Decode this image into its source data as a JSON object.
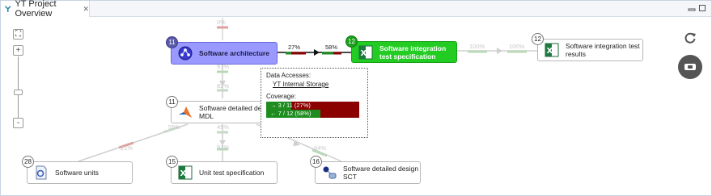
{
  "window": {
    "tab_title": "YT Project Overview",
    "tab_close": "✕",
    "icons": [
      "project-overview-icon",
      "minimize-icon",
      "maximize-icon"
    ]
  },
  "zoom": {
    "fit_label": "⛶",
    "plus_label": "+",
    "minus_label": "-"
  },
  "colors": {
    "selected": "#9999ff",
    "active": "#22cc22",
    "covered": "#1e8c1e",
    "uncovered": "#8b0000",
    "faint": "#c8c8c8"
  },
  "nodes": {
    "architecture": {
      "count": "11",
      "label": "Software architecture",
      "icon": "architecture-icon"
    },
    "integration_spec": {
      "count": "12",
      "label": "Software integration test specification",
      "icon": "excel-icon"
    },
    "integration_results": {
      "count": "12",
      "label": "Software integration test results",
      "icon": "excel-icon"
    },
    "detailed_mdl": {
      "count": "11",
      "label": "Software detailed design MDL",
      "icon": "matlab-icon"
    },
    "units": {
      "count": "28",
      "label": "Software units",
      "icon": "code-file-icon"
    },
    "unit_test": {
      "count": "15",
      "label": "Unit test specification",
      "icon": "excel-icon"
    },
    "detailed_sct": {
      "count": "16",
      "label": "Software detailed design SCT",
      "icon": "statechart-icon"
    }
  },
  "edge_labels": {
    "arch_to_spec_left": "27%",
    "arch_to_spec_right": "58%",
    "spec_to_results_left": "100%",
    "spec_to_results_right": "100%",
    "above_arch": "0%",
    "arch_to_mdl_top": "91%",
    "arch_to_mdl_bottom": "82%",
    "mdl_left_top": "55%",
    "mdl_center_top": "45%",
    "mdl_right_top": "0%",
    "to_units": "21%",
    "to_unit_test": "91%",
    "to_sct": "64%"
  },
  "tooltip": {
    "data_accesses_label": "Data Accesses:",
    "storage_link": "YT Internal Storage",
    "coverage_label": "Coverage:",
    "forward_text": "→ 3 / 11 (27%)",
    "forward_fraction": 0.27,
    "backward_text": "← 7 / 12 (58%)",
    "backward_fraction": 0.58
  },
  "right_buttons": {
    "refresh_icon": "refresh-icon",
    "capture_icon": "camera-icon"
  }
}
